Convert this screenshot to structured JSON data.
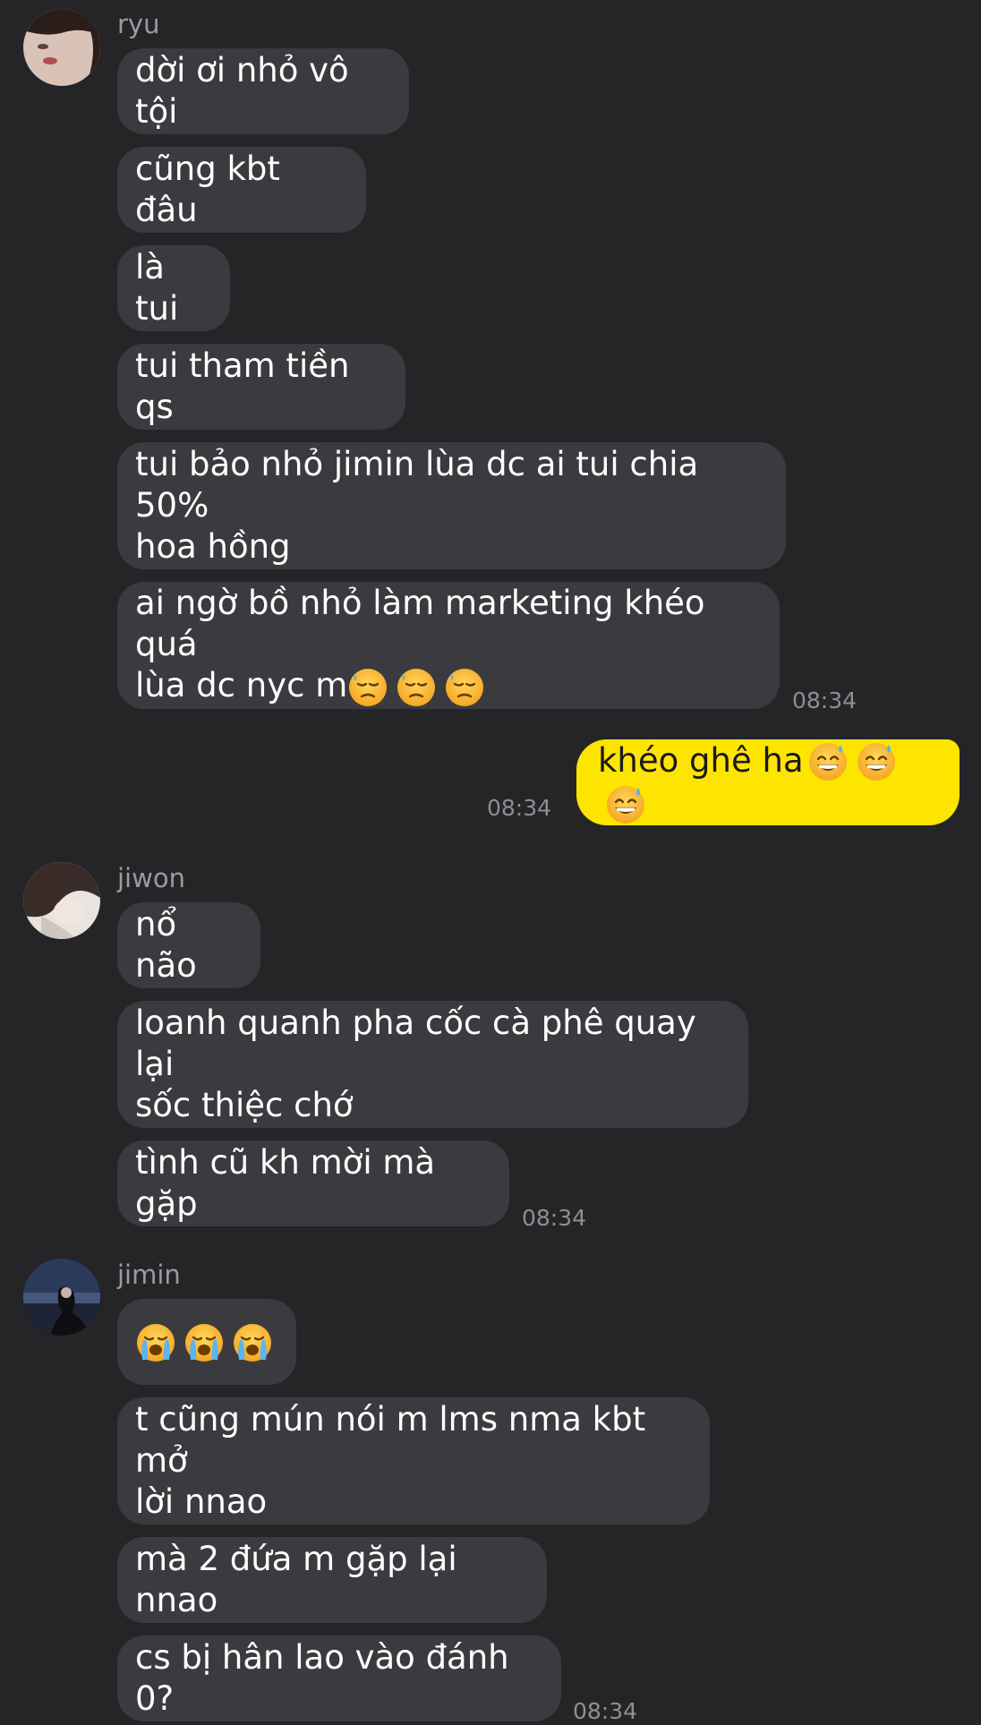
{
  "groups": [
    {
      "sender": "ryu",
      "messages": [
        {
          "text": "dời ơi nhỏ vô tội"
        },
        {
          "text": "cũng kbt đâu"
        },
        {
          "text": "là tui"
        },
        {
          "text": "tui tham tiền qs"
        },
        {
          "text": "tui bảo nhỏ jimin lùa dc ai tui chia 50%\nhoa hồng"
        },
        {
          "text": "ai ngờ bồ nhỏ làm marketing khéo quá\nlùa dc nyc m",
          "emoji": [
            "downcast-sweat-face",
            "downcast-sweat-face",
            "downcast-sweat-face"
          ]
        }
      ],
      "time": "08:34"
    },
    {
      "sender": "me",
      "messages": [
        {
          "text": "khéo ghê ha",
          "emoji": [
            "grinning-sweat-face",
            "grinning-sweat-face",
            "grinning-sweat-face"
          ]
        }
      ],
      "time": "08:34"
    },
    {
      "sender": "jiwon",
      "messages": [
        {
          "text": "nổ não"
        },
        {
          "text": "loanh quanh pha cốc cà phê quay lại\nsốc thiệc chớ"
        },
        {
          "text": "tình cũ kh mời mà gặp"
        }
      ],
      "time": "08:34"
    },
    {
      "sender": "jimin",
      "messages": [
        {
          "text": "",
          "emoji": [
            "loudly-crying-face",
            "loudly-crying-face",
            "loudly-crying-face"
          ]
        },
        {
          "text": "t cũng mún nói m lms nma kbt mở\nlời nnao"
        },
        {
          "text": "mà 2 đứa m gặp lại nnao"
        },
        {
          "text": "cs bị hân lao vào đánh 0?"
        }
      ],
      "time": "08:34"
    }
  ],
  "colors": {
    "background": "#252528",
    "incoming_bubble": "#3b3b3f",
    "outgoing_bubble": "#fee500",
    "timestamp": "#8e8e93"
  }
}
